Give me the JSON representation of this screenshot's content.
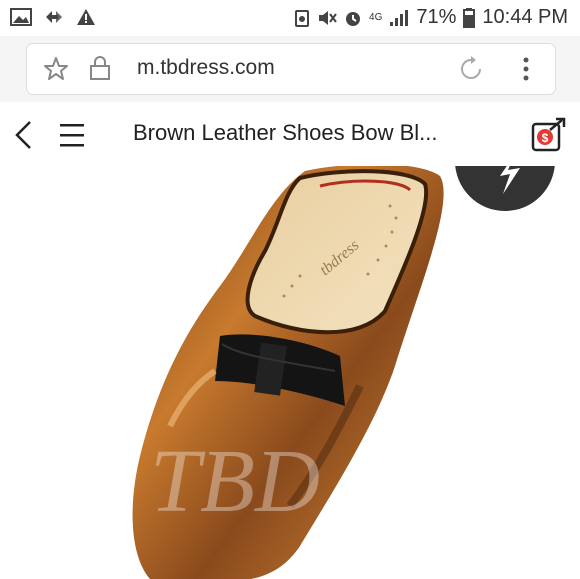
{
  "status_bar": {
    "battery": "71%",
    "time": "10:44 PM",
    "network": "4G"
  },
  "browser": {
    "url": "m.tbdress.com"
  },
  "page": {
    "title": "Brown Leather Shoes Bow Bl..."
  },
  "product_image": {
    "watermark": "TBD",
    "description_icon": "shoe-photo"
  },
  "colors": {
    "share_badge": "#e53935",
    "leather_dark": "#4a2a14",
    "leather_light": "#c87a2e"
  }
}
